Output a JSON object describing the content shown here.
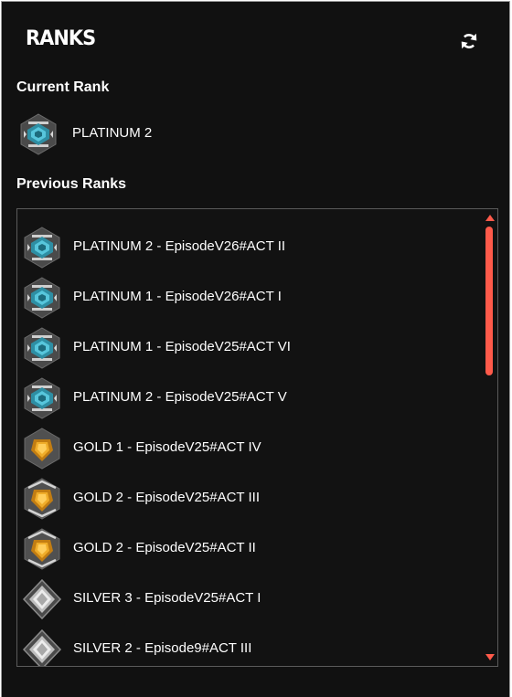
{
  "app": {
    "logo_text": "RANKS",
    "refresh_icon": "refresh-icon"
  },
  "current": {
    "heading": "Current Rank",
    "rank": {
      "label": "PLATINUM 2",
      "tier": "platinum"
    }
  },
  "previous": {
    "heading": "Previous Ranks",
    "items": [
      {
        "label": "PLATINUM 2 - EpisodeV26#ACT II",
        "tier": "platinum"
      },
      {
        "label": "PLATINUM 1 - EpisodeV26#ACT I",
        "tier": "platinum"
      },
      {
        "label": "PLATINUM 1 - EpisodeV25#ACT VI",
        "tier": "platinum"
      },
      {
        "label": "PLATINUM 2 - EpisodeV25#ACT V",
        "tier": "platinum"
      },
      {
        "label": "GOLD 1 - EpisodeV25#ACT IV",
        "tier": "gold1"
      },
      {
        "label": "GOLD 2 - EpisodeV25#ACT III",
        "tier": "gold"
      },
      {
        "label": "GOLD 2 - EpisodeV25#ACT II",
        "tier": "gold"
      },
      {
        "label": "SILVER 3 - EpisodeV25#ACT I",
        "tier": "silver"
      },
      {
        "label": "SILVER 2 - Episode9#ACT III",
        "tier": "silver"
      }
    ]
  },
  "colors": {
    "background": "#111111",
    "accent": "#ff5a4a",
    "platinum": "#3aa9bf",
    "gold": "#e0a020",
    "silver": "#d8d8d8"
  }
}
